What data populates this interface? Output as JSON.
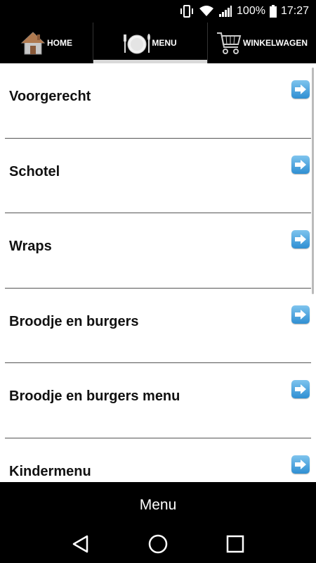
{
  "status_bar": {
    "battery": "100%",
    "time": "17:27",
    "icons": [
      "vibrate-icon",
      "wifi-icon",
      "signal-icon",
      "battery-icon"
    ]
  },
  "nav": {
    "tabs": [
      {
        "label": "HOME",
        "icon": "house-icon"
      },
      {
        "label": "MENU",
        "icon": "plate-cutlery-icon",
        "active": true
      },
      {
        "label": "WINKELWAGEN",
        "icon": "shopping-cart-icon"
      }
    ]
  },
  "menu": {
    "items": [
      {
        "label": "Voorgerecht"
      },
      {
        "label": "Schotel"
      },
      {
        "label": "Wraps"
      },
      {
        "label": "Broodje en burgers"
      },
      {
        "label": "Broodje en burgers menu"
      },
      {
        "label": "Kindermenu"
      }
    ],
    "arrow_icon": "arrow-right-icon",
    "accent_color": "#2f8fd2"
  },
  "bottom_bar": {
    "title": "Menu"
  },
  "system_nav": {
    "buttons": [
      "back-icon",
      "home-circle-icon",
      "recents-icon"
    ]
  }
}
